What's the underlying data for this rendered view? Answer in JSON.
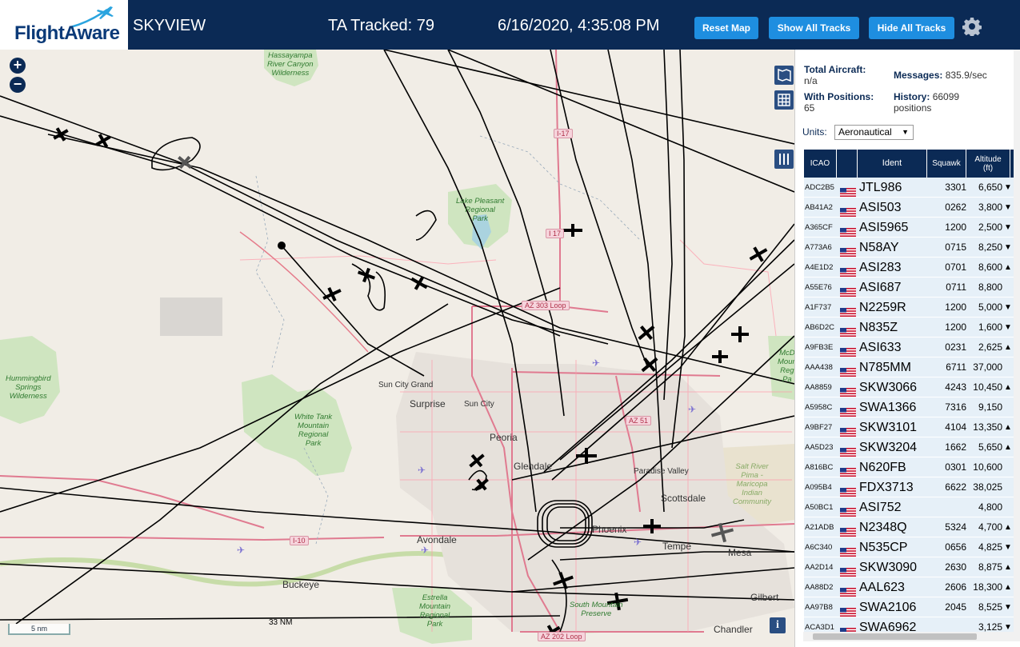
{
  "header": {
    "logo_text": "FlightAware",
    "app_name": "SKYVIEW",
    "tracked": "TA Tracked: 79",
    "datetime": "6/16/2020, 4:35:08 PM",
    "reset_label": "Reset Map",
    "show_label": "Show All Tracks",
    "hide_label": "Hide All Tracks",
    "settings_icon": "gear-icon"
  },
  "map": {
    "zoom_in": "+",
    "zoom_out": "−",
    "scale_label": "5 nm",
    "range_label": "33 NM",
    "info_label": "i",
    "places": [
      {
        "name": "Sun City Grand"
      },
      {
        "name": "Surprise"
      },
      {
        "name": "Sun City"
      },
      {
        "name": "Peoria"
      },
      {
        "name": "Glendale"
      },
      {
        "name": "Paradise Valley"
      },
      {
        "name": "Scottsdale"
      },
      {
        "name": "Phoenix"
      },
      {
        "name": "Tempe"
      },
      {
        "name": "Mesa"
      },
      {
        "name": "Avondale"
      },
      {
        "name": "Buckeye"
      },
      {
        "name": "Chandler"
      },
      {
        "name": "Gilbert"
      }
    ],
    "parks": [
      {
        "name": "Hassayampa\nRiver Canyon\nWilderness"
      },
      {
        "name": "Lake Pleasant\nRegional\nPark"
      },
      {
        "name": "Hummingbird\nSprings\nWilderness"
      },
      {
        "name": "White Tank\nMountain\nRegional\nPark"
      },
      {
        "name": "Estrella\nMountain\nRegional\nPark"
      },
      {
        "name": "South Mountain\nPreserve"
      },
      {
        "name": "Salt River\nPima -\nMaricopa\nIndian\nCommunity"
      },
      {
        "name": "McD\nMoun\nReg\nPa"
      }
    ],
    "roads": [
      {
        "name": "I-17"
      },
      {
        "name": "I 17"
      },
      {
        "name": "AZ 303 Loop"
      },
      {
        "name": "AZ 51"
      },
      {
        "name": "I-10"
      },
      {
        "name": "AZ 202 Loop"
      }
    ]
  },
  "stats": {
    "total_label": "Total Aircraft:",
    "total_value": "n/a",
    "positions_label": "With Positions:",
    "positions_value": "65",
    "messages_label": "Messages:",
    "messages_value": "835.9/sec",
    "history_label": "History:",
    "history_value": "66099",
    "history_unit": "positions",
    "units_label": "Units:",
    "units_value": "Aeronautical"
  },
  "table": {
    "headers": {
      "icao": "ICAO",
      "ident": "Ident",
      "squawk": "Squawk",
      "altitude": "Altitude\n(ft)"
    },
    "rows": [
      {
        "icao": "ADC2B5",
        "ident": "JTL986",
        "squawk": "3301",
        "alt": "6,650",
        "trend": "▼"
      },
      {
        "icao": "AB41A2",
        "ident": "ASI503",
        "squawk": "0262",
        "alt": "3,800",
        "trend": "▼"
      },
      {
        "icao": "A365CF",
        "ident": "ASI5965",
        "squawk": "1200",
        "alt": "2,500",
        "trend": "▼"
      },
      {
        "icao": "A773A6",
        "ident": "N58AY",
        "squawk": "0715",
        "alt": "8,250",
        "trend": "▼"
      },
      {
        "icao": "A4E1D2",
        "ident": "ASI283",
        "squawk": "0701",
        "alt": "8,600",
        "trend": "▲"
      },
      {
        "icao": "A55E76",
        "ident": "ASI687",
        "squawk": "0711",
        "alt": "8,800",
        "trend": ""
      },
      {
        "icao": "A1F737",
        "ident": "N2259R",
        "squawk": "1200",
        "alt": "5,000",
        "trend": "▼"
      },
      {
        "icao": "AB6D2C",
        "ident": "N835Z",
        "squawk": "1200",
        "alt": "1,600",
        "trend": "▼"
      },
      {
        "icao": "A9FB3E",
        "ident": "ASI633",
        "squawk": "0231",
        "alt": "2,625",
        "trend": "▲"
      },
      {
        "icao": "AAA438",
        "ident": "N785MM",
        "squawk": "6711",
        "alt": "37,000",
        "trend": ""
      },
      {
        "icao": "AA8859",
        "ident": "SKW3066",
        "squawk": "4243",
        "alt": "10,450",
        "trend": "▲"
      },
      {
        "icao": "A5958C",
        "ident": "SWA1366",
        "squawk": "7316",
        "alt": "9,150",
        "trend": ""
      },
      {
        "icao": "A9BF27",
        "ident": "SKW3101",
        "squawk": "4104",
        "alt": "13,350",
        "trend": "▲"
      },
      {
        "icao": "AA5D23",
        "ident": "SKW3204",
        "squawk": "1662",
        "alt": "5,650",
        "trend": "▲"
      },
      {
        "icao": "A816BC",
        "ident": "N620FB",
        "squawk": "0301",
        "alt": "10,600",
        "trend": ""
      },
      {
        "icao": "A095B4",
        "ident": "FDX3713",
        "squawk": "6622",
        "alt": "38,025",
        "trend": ""
      },
      {
        "icao": "A50BC1",
        "ident": "ASI752",
        "squawk": "",
        "alt": "4,800",
        "trend": ""
      },
      {
        "icao": "A21ADB",
        "ident": "N2348Q",
        "squawk": "5324",
        "alt": "4,700",
        "trend": "▲"
      },
      {
        "icao": "A6C340",
        "ident": "N535CP",
        "squawk": "0656",
        "alt": "4,825",
        "trend": "▼"
      },
      {
        "icao": "AA2D14",
        "ident": "SKW3090",
        "squawk": "2630",
        "alt": "8,875",
        "trend": "▲"
      },
      {
        "icao": "AA88D2",
        "ident": "AAL623",
        "squawk": "2606",
        "alt": "18,300",
        "trend": "▲"
      },
      {
        "icao": "AA97B8",
        "ident": "SWA2106",
        "squawk": "2045",
        "alt": "8,525",
        "trend": "▼"
      },
      {
        "icao": "ACA3D1",
        "ident": "SWA6962",
        "squawk": "",
        "alt": "3,125",
        "trend": "▼"
      }
    ]
  },
  "colors": {
    "header_bg": "#0b2a55",
    "button": "#1e8ee0",
    "row_bg": "#e6f0f8",
    "map_bg": "#f1ede6",
    "road": "#e07a90",
    "park": "#cfe5c0"
  }
}
